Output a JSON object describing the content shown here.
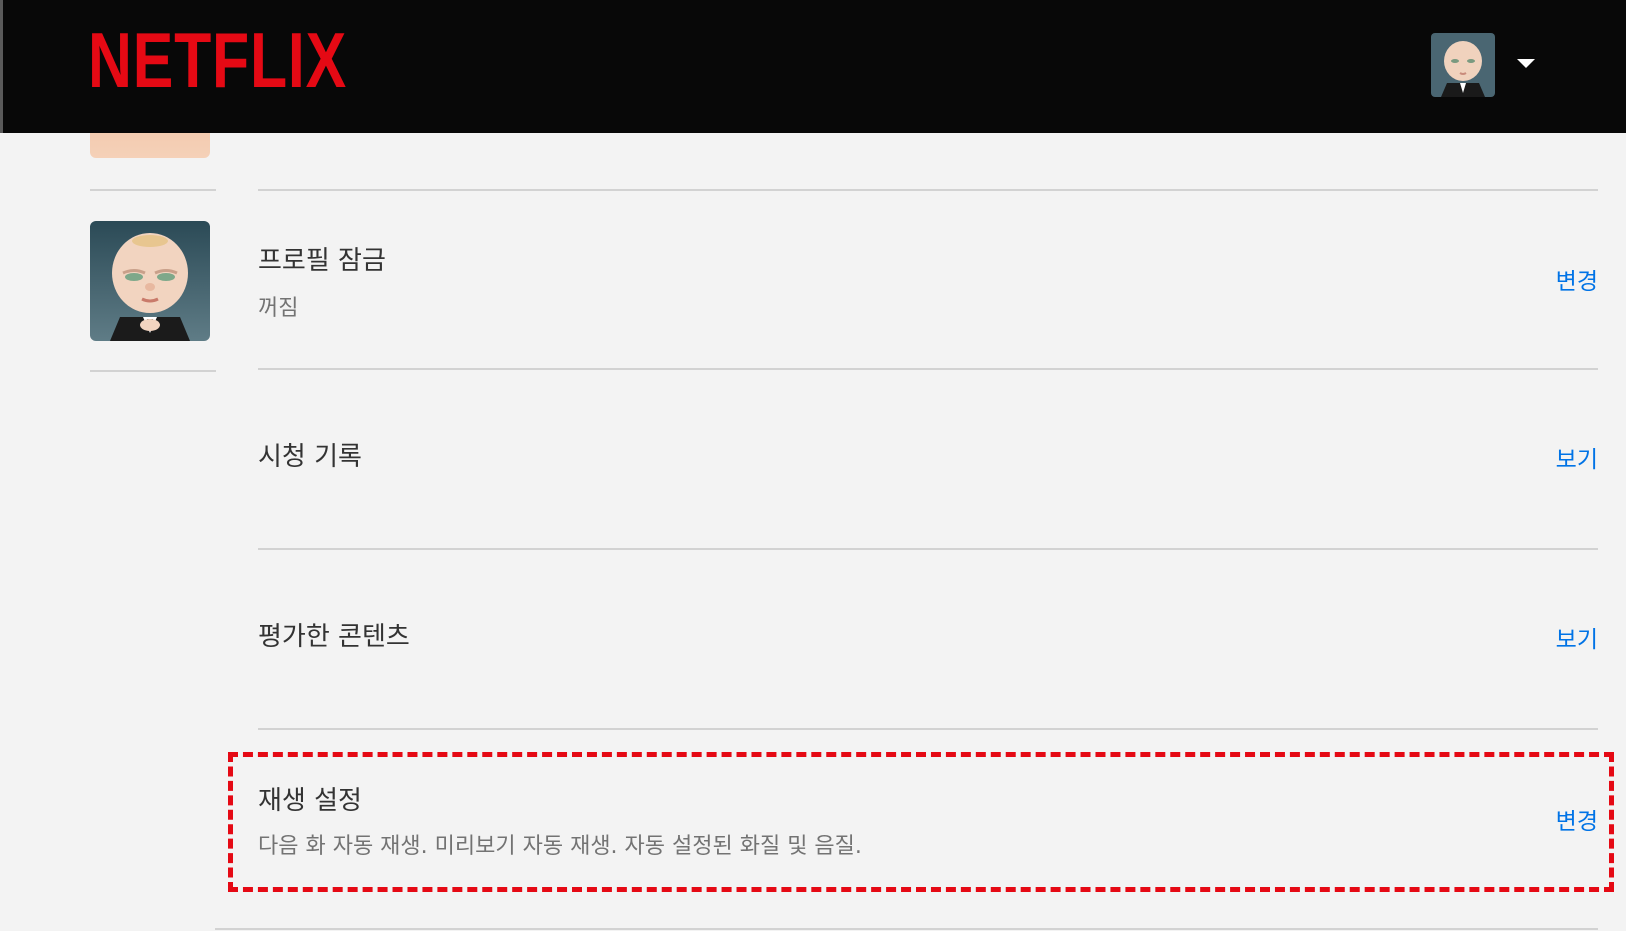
{
  "header": {
    "logo": "NETFLIX",
    "profile_avatar": "boss-baby-avatar",
    "menu_icon": "caret-down-icon"
  },
  "profile": {
    "avatar": "boss-baby-avatar"
  },
  "settings": [
    {
      "title": "프로필 잠금",
      "subtitle": "꺼짐",
      "action": "변경"
    },
    {
      "title": "시청 기록",
      "subtitle": "",
      "action": "보기"
    },
    {
      "title": "평가한 콘텐츠",
      "subtitle": "",
      "action": "보기"
    },
    {
      "title": "재생 설정",
      "subtitle": "다음 화 자동 재생. 미리보기 자동 재생. 자동 설정된 화질 및 음질.",
      "action": "변경"
    }
  ],
  "colors": {
    "brand": "#e50914",
    "link": "#0073e6",
    "background": "#f3f3f3",
    "header": "#080808"
  }
}
